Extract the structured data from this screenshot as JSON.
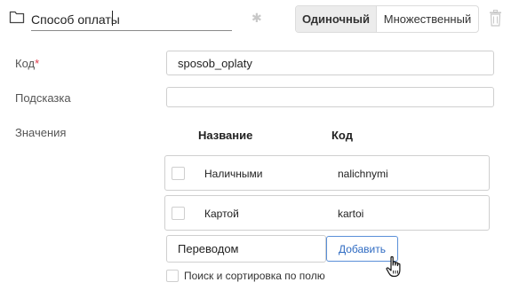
{
  "header": {
    "field_name": "Способ оплаты",
    "icons": {
      "folder": "folder-icon",
      "required": "asterisk-icon",
      "delete": "trash-icon"
    },
    "mode_toggle": {
      "single_label": "Одиночный",
      "multiple_label": "Множественный",
      "selected": "single"
    }
  },
  "form": {
    "code": {
      "label": "Код",
      "required_mark": "*",
      "value": "sposob_oplaty"
    },
    "hint": {
      "label": "Подсказка",
      "value": ""
    },
    "values": {
      "label": "Значения",
      "columns": {
        "name": "Название",
        "code": "Код"
      },
      "rows": [
        {
          "name": "Наличными",
          "code": "nalichnymi"
        },
        {
          "name": "Картой",
          "code": "kartoi"
        }
      ],
      "new_value": "Переводом",
      "add_label": "Добавить"
    },
    "search_sort_label": "Поиск и сортировка по полю"
  },
  "colors": {
    "accent": "#2f6bc2",
    "required": "#e0394a",
    "border": "#cfcfcf"
  }
}
